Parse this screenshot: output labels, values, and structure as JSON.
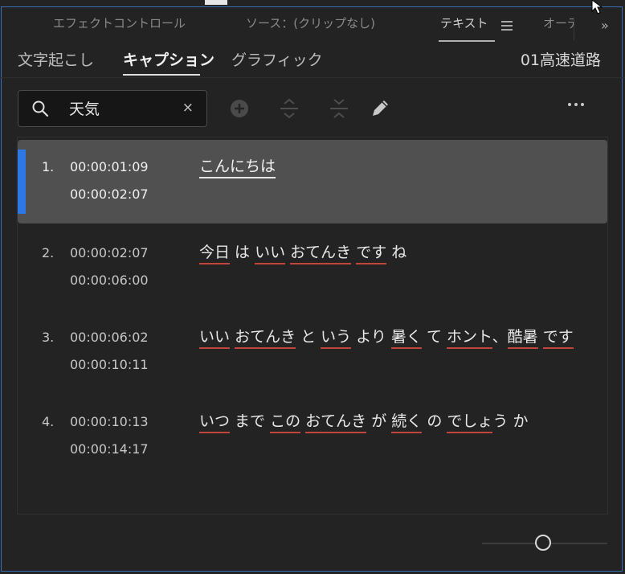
{
  "panel_tabs": [
    "エフェクトコントロール",
    "ソース：(クリップなし)",
    "テキスト",
    "オーデ"
  ],
  "overflow": "»",
  "subtabs": [
    "文字起こし",
    "キャプション",
    "グラフィック"
  ],
  "sequence_name": "01高速道路",
  "search": {
    "value": "天気",
    "clear": "×"
  },
  "captions": [
    {
      "num": "1.",
      "in": "00:00:01:09",
      "out": "00:00:02:07",
      "words": [
        {
          "t": "こんにちは",
          "u": true
        }
      ]
    },
    {
      "num": "2.",
      "in": "00:00:02:07",
      "out": "00:00:06:00",
      "words": [
        {
          "t": "今日",
          "u": true
        },
        {
          "t": " は ",
          "u": false
        },
        {
          "t": "いい",
          "u": true
        },
        {
          "t": " ",
          "u": false
        },
        {
          "t": "おてんき",
          "u": true
        },
        {
          "t": " ",
          "u": false
        },
        {
          "t": "です",
          "u": true
        },
        {
          "t": " ね",
          "u": false
        }
      ]
    },
    {
      "num": "3.",
      "in": "00:00:06:02",
      "out": "00:00:10:11",
      "words": [
        {
          "t": "いい",
          "u": true
        },
        {
          "t": " ",
          "u": false
        },
        {
          "t": "おてんき",
          "u": true
        },
        {
          "t": " と ",
          "u": false
        },
        {
          "t": "いう",
          "u": true
        },
        {
          "t": " より ",
          "u": false
        },
        {
          "t": "暑く",
          "u": true
        },
        {
          "t": " て ",
          "u": false
        },
        {
          "t": "ホント",
          "u": true
        },
        {
          "t": "、",
          "u": false
        },
        {
          "t": "酷暑",
          "u": true
        },
        {
          "t": " ",
          "u": false
        },
        {
          "t": "です",
          "u": true
        }
      ]
    },
    {
      "num": "4.",
      "in": "00:00:10:13",
      "out": "00:00:14:17",
      "words": [
        {
          "t": "いつ",
          "u": true
        },
        {
          "t": " まで ",
          "u": false
        },
        {
          "t": "この",
          "u": true
        },
        {
          "t": " ",
          "u": false
        },
        {
          "t": "おてんき",
          "u": true
        },
        {
          "t": " が ",
          "u": false
        },
        {
          "t": "続く",
          "u": true
        },
        {
          "t": " の ",
          "u": false
        },
        {
          "t": "でしょ",
          "u": true
        },
        {
          "t": "う か",
          "u": false
        }
      ]
    }
  ],
  "selected_index": 0,
  "colors": {
    "accent": "#2d78e6",
    "underline": "#c0453a",
    "selected_bg": "#505050"
  },
  "icons": [
    "search-icon",
    "clear-icon",
    "add-caption-icon",
    "split-caption-icon",
    "merge-caption-icon",
    "edit-icon",
    "more-options-icon"
  ]
}
